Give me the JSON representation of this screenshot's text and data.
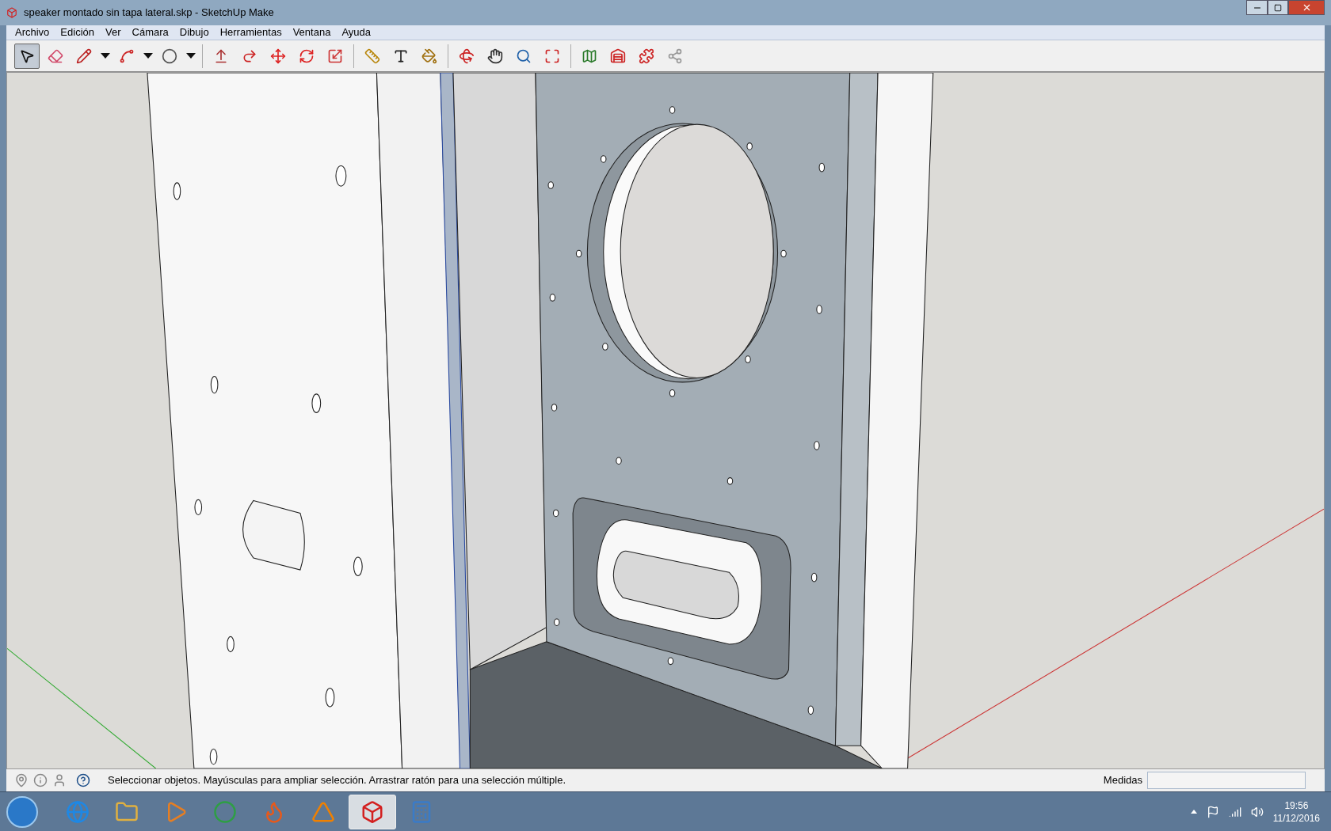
{
  "window": {
    "title": "speaker montado sin tapa lateral.skp - SketchUp Make"
  },
  "menu": [
    "Archivo",
    "Edición",
    "Ver",
    "Cámara",
    "Dibujo",
    "Herramientas",
    "Ventana",
    "Ayuda"
  ],
  "tool_groups": [
    [
      {
        "kind": "select",
        "selected": true
      },
      {
        "kind": "eraser",
        "selected": false
      },
      {
        "kind": "pencil",
        "selected": false
      },
      {
        "kind": "dropdown",
        "selected": false
      },
      {
        "kind": "arc",
        "selected": false
      },
      {
        "kind": "dropdown",
        "selected": false
      },
      {
        "kind": "circle",
        "selected": false
      },
      {
        "kind": "dropdown",
        "selected": false
      }
    ],
    [
      {
        "kind": "pushpull",
        "selected": false
      },
      {
        "kind": "followme",
        "selected": false
      },
      {
        "kind": "move",
        "selected": false
      },
      {
        "kind": "rotate",
        "selected": false
      },
      {
        "kind": "scale",
        "selected": false
      }
    ],
    [
      {
        "kind": "tape",
        "selected": false
      },
      {
        "kind": "text",
        "selected": false
      },
      {
        "kind": "paint",
        "selected": false
      }
    ],
    [
      {
        "kind": "orbit",
        "selected": false
      },
      {
        "kind": "pan",
        "selected": false
      },
      {
        "kind": "zoom",
        "selected": false
      },
      {
        "kind": "extents",
        "selected": false
      }
    ],
    [
      {
        "kind": "map",
        "selected": false
      },
      {
        "kind": "warehouse",
        "selected": false
      },
      {
        "kind": "extension",
        "selected": false
      },
      {
        "kind": "share",
        "selected": false
      }
    ]
  ],
  "status_bar": {
    "hint": "Seleccionar objetos. Mayúsculas para ampliar selección. Arrastrar ratón para una selección múltiple.",
    "measure_label": "Medidas"
  },
  "taskbar": {
    "apps": [
      {
        "kind": "browser-e",
        "active": false
      },
      {
        "kind": "folder",
        "active": false
      },
      {
        "kind": "player",
        "active": false
      },
      {
        "kind": "chrome",
        "active": false
      },
      {
        "kind": "fox",
        "active": false
      },
      {
        "kind": "cone",
        "active": false
      },
      {
        "kind": "sketch",
        "active": true
      },
      {
        "kind": "calculator",
        "active": false
      }
    ],
    "time": "19:56",
    "date": "11/12/2016"
  }
}
